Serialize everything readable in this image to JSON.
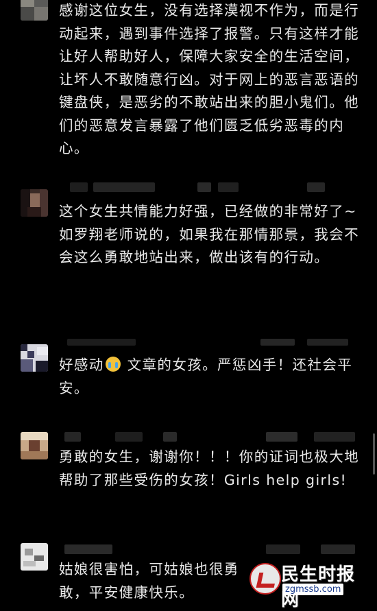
{
  "comments": [
    {
      "text": "感谢这位女生，没有选择漠视不作为，而是行动起来，遇到事件选择了报警。只有这样才能让好人帮助好人，保障大家安全的生活空间，让坏人不敢随意行凶。对于网上的恶言恶语的键盘侠，是恶劣的不敢站出来的胆小鬼们。他们的恶意发言暴露了他们匮乏低劣恶毒的内心。"
    },
    {
      "text": "这个女生共情能力好强，已经做的非常好了~\n如罗翔老师说的，如果我在那情那景，我会不会这么勇敢地站出来，做出该有的行动。"
    },
    {
      "text_before": "好感动",
      "emoji": "crying-face-emoji",
      "text_after": " 文章的女孩。严惩凶手！还社会平安。"
    },
    {
      "text": "勇敢的女生，谢谢你！！！你的证词也极大地帮助了那些受伤的女孩！Girls help girls!"
    },
    {
      "text": "姑娘很害怕，可姑娘也很勇敢，平安健康快乐。"
    }
  ],
  "watermark": {
    "title": "民生时报网",
    "url": "zgmssb.com"
  },
  "colors": {
    "background": "#000000",
    "text": "#e9e9e9",
    "blurred_meta": "#2f2f2f"
  }
}
